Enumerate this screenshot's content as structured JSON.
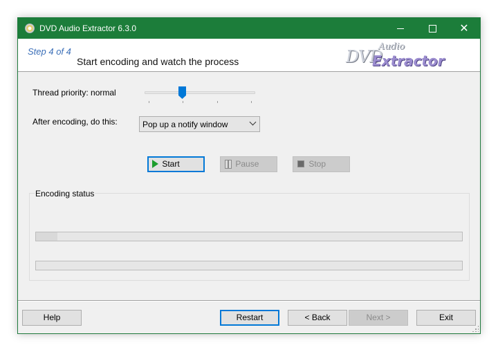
{
  "window": {
    "title": "DVD Audio Extractor 6.3.0",
    "controls": {
      "minimize": "–",
      "maximize": "☐",
      "close": "✕"
    },
    "accent_color": "#1c7d3a"
  },
  "header": {
    "step": "Step 4 of 4",
    "title": "Start encoding and watch the process",
    "logo": {
      "line1": "DVD",
      "line2": "Audio",
      "line3": "Extractor"
    }
  },
  "settings": {
    "thread_priority_label": "Thread priority:  normal",
    "thread_priority": {
      "value_index": 2,
      "ticks": 5
    },
    "after_encoding_label": "After encoding, do this:",
    "after_encoding_selected": "Pop up a notify window"
  },
  "controls": {
    "start_label": "Start",
    "pause_label": "Pause",
    "stop_label": "Stop",
    "icons": {
      "start": "play-icon",
      "pause": "pause-icon",
      "stop": "stop-icon"
    }
  },
  "encoding_status": {
    "title": "Encoding status",
    "progress_bars": [
      {
        "name": "current-progress",
        "fraction": 0.05
      },
      {
        "name": "total-progress",
        "fraction": 0.0
      }
    ]
  },
  "footer": {
    "help_label": "Help",
    "restart_label": "Restart",
    "back_label": "< Back",
    "next_label": "Next >",
    "exit_label": "Exit"
  }
}
